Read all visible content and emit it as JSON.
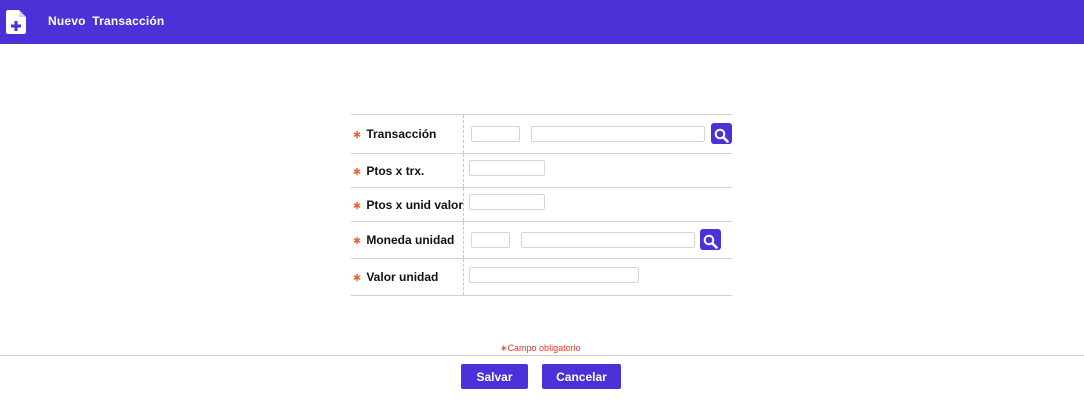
{
  "header": {
    "title": "Nuevo Transacción",
    "icon": "new-document-icon",
    "background": "#4a31d8"
  },
  "form": {
    "required_marker": "∗",
    "rows": [
      {
        "label": "Transacción",
        "code_value": "",
        "description_value": "",
        "has_search": true
      },
      {
        "label": "Ptos x trx.",
        "value": ""
      },
      {
        "label": "Ptos x unid valor",
        "value": ""
      },
      {
        "label": "Moneda unidad",
        "code_value": "",
        "description_value": "",
        "has_search": true
      },
      {
        "label": "Valor unidad",
        "value": ""
      }
    ],
    "search_icon": "magnifier-icon"
  },
  "required_note": "∗Campo obligatorio",
  "actions": {
    "save_label": "Salvar",
    "cancel_label": "Cancelar"
  },
  "colors": {
    "accent": "#4a31d8",
    "required": "#e55a2b"
  }
}
